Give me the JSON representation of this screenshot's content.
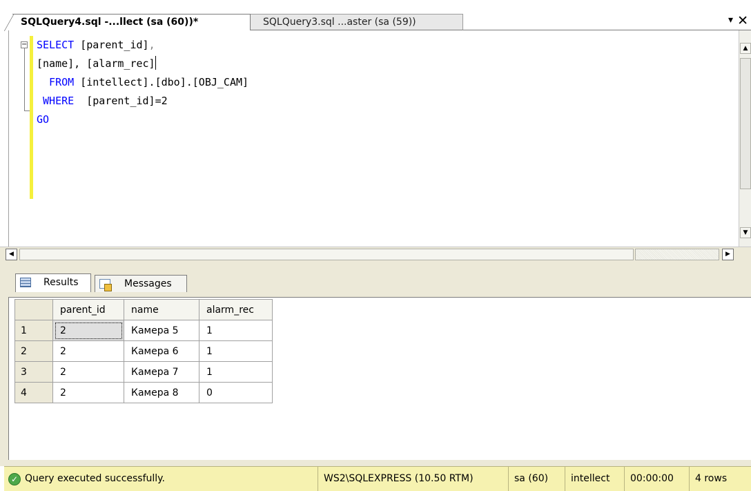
{
  "tabs": [
    {
      "label": "SQLQuery4.sql -...llect (sa (60))*",
      "active": true
    },
    {
      "label": "SQLQuery3.sql ...aster (sa (59))",
      "active": false
    }
  ],
  "tab_controls": {
    "dropdown_glyph": "▾",
    "close_glyph": "✕"
  },
  "editor": {
    "lines": [
      {
        "kw": "SELECT",
        "text": " [parent_id]",
        "sep": ","
      },
      {
        "kw": "",
        "text": "[name], [alarm_rec]",
        "sep": ""
      },
      {
        "kw": "  FROM",
        "text": " [intellect].[dbo].[OBJ_CAM]",
        "sep": ""
      },
      {
        "kw": " WHERE",
        "text": "  [parent_id]=2",
        "sep": ""
      },
      {
        "kw": "GO",
        "text": "",
        "sep": ""
      }
    ]
  },
  "results_tabs": {
    "results": "Results",
    "messages": "Messages"
  },
  "grid": {
    "columns": [
      "parent_id",
      "name",
      "alarm_rec"
    ],
    "rows": [
      {
        "num": "1",
        "cells": [
          "2",
          "Камера 5",
          "1"
        ]
      },
      {
        "num": "2",
        "cells": [
          "2",
          "Камера 6",
          "1"
        ]
      },
      {
        "num": "3",
        "cells": [
          "2",
          "Камера 7",
          "1"
        ]
      },
      {
        "num": "4",
        "cells": [
          "2",
          "Камера 8",
          "0"
        ]
      }
    ]
  },
  "status": {
    "message": "Query executed successfully.",
    "server": "WS2\\SQLEXPRESS (10.50 RTM)",
    "user": "sa (60)",
    "database": "intellect",
    "elapsed": "00:00:00",
    "rows": "4 rows"
  },
  "colors": {
    "keyword": "#0000ff",
    "status_bar": "#f6f2b0",
    "change_marker": "#f5f03c"
  }
}
